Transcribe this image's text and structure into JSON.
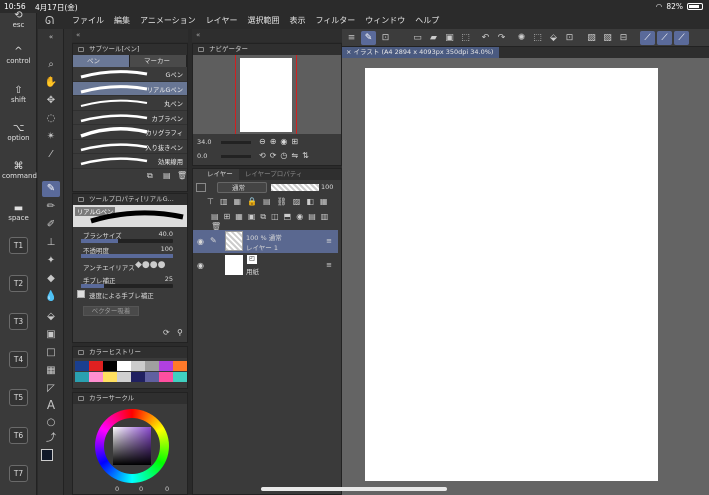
{
  "status": {
    "time": "10:56",
    "date": "4月17日(金)",
    "battery": "82%"
  },
  "menu": [
    "ファイル",
    "編集",
    "アニメーション",
    "レイヤー",
    "選択範囲",
    "表示",
    "フィルター",
    "ウィンドウ",
    "ヘルプ"
  ],
  "keys": {
    "esc": "esc",
    "control": "control",
    "shift": "shift",
    "option": "option",
    "command": "command",
    "space": "space",
    "t": [
      "T1",
      "T2",
      "T3",
      "T4",
      "T5",
      "T6",
      "T7"
    ]
  },
  "subtool": {
    "title": "サブツール[ペン]",
    "tabs": [
      "ペン",
      "マーカー"
    ],
    "brushes": [
      "Gペン",
      "リアルGペン",
      "丸ペン",
      "カブラペン",
      "カリグラフィ",
      "入り抜きペン",
      "効果線用"
    ]
  },
  "toolprop": {
    "title": "ツールプロパティ[リアルG...",
    "preview_name": "リアルGペン",
    "brush_size_label": "ブラシサイズ",
    "brush_size": "40.0",
    "opacity_label": "不透明度",
    "opacity": "100",
    "antialias_label": "アンチエイリアス",
    "stabilization_label": "手ブレ補正",
    "stabilization": "25",
    "speed_label": "速度による手ブレ補正",
    "vector_label": "ベクター吸着"
  },
  "color_history": {
    "title": "カラーヒストリー",
    "colors": [
      "#1a3f8f",
      "#e02020",
      "#000000",
      "#ffffff",
      "#cccccc",
      "#a0a0a0",
      "#b040e0",
      "#ff7a2a",
      "#2aa0b0",
      "#ff8fd0",
      "#ffe060",
      "#d0d0d0",
      "#202060",
      "#6060a0",
      "#ff4fa0",
      "#40d0c0"
    ]
  },
  "color_circle": {
    "title": "カラーサークル",
    "values": [
      "0",
      "0",
      "0"
    ]
  },
  "navigator": {
    "title": "ナビゲーター",
    "zoom": "34.0",
    "angle": "0.0"
  },
  "layer": {
    "tabs": [
      "レイヤー",
      "レイヤープロパティ"
    ],
    "blend": "通常",
    "opacity": "100",
    "layers": [
      {
        "line1": "100 % 通常",
        "line2": "レイヤー 1"
      },
      {
        "line1": "",
        "line2": "用紙"
      }
    ]
  },
  "document": {
    "tab": "イラスト (A4 2894 x 4093px 350dpi 34.0%)"
  }
}
